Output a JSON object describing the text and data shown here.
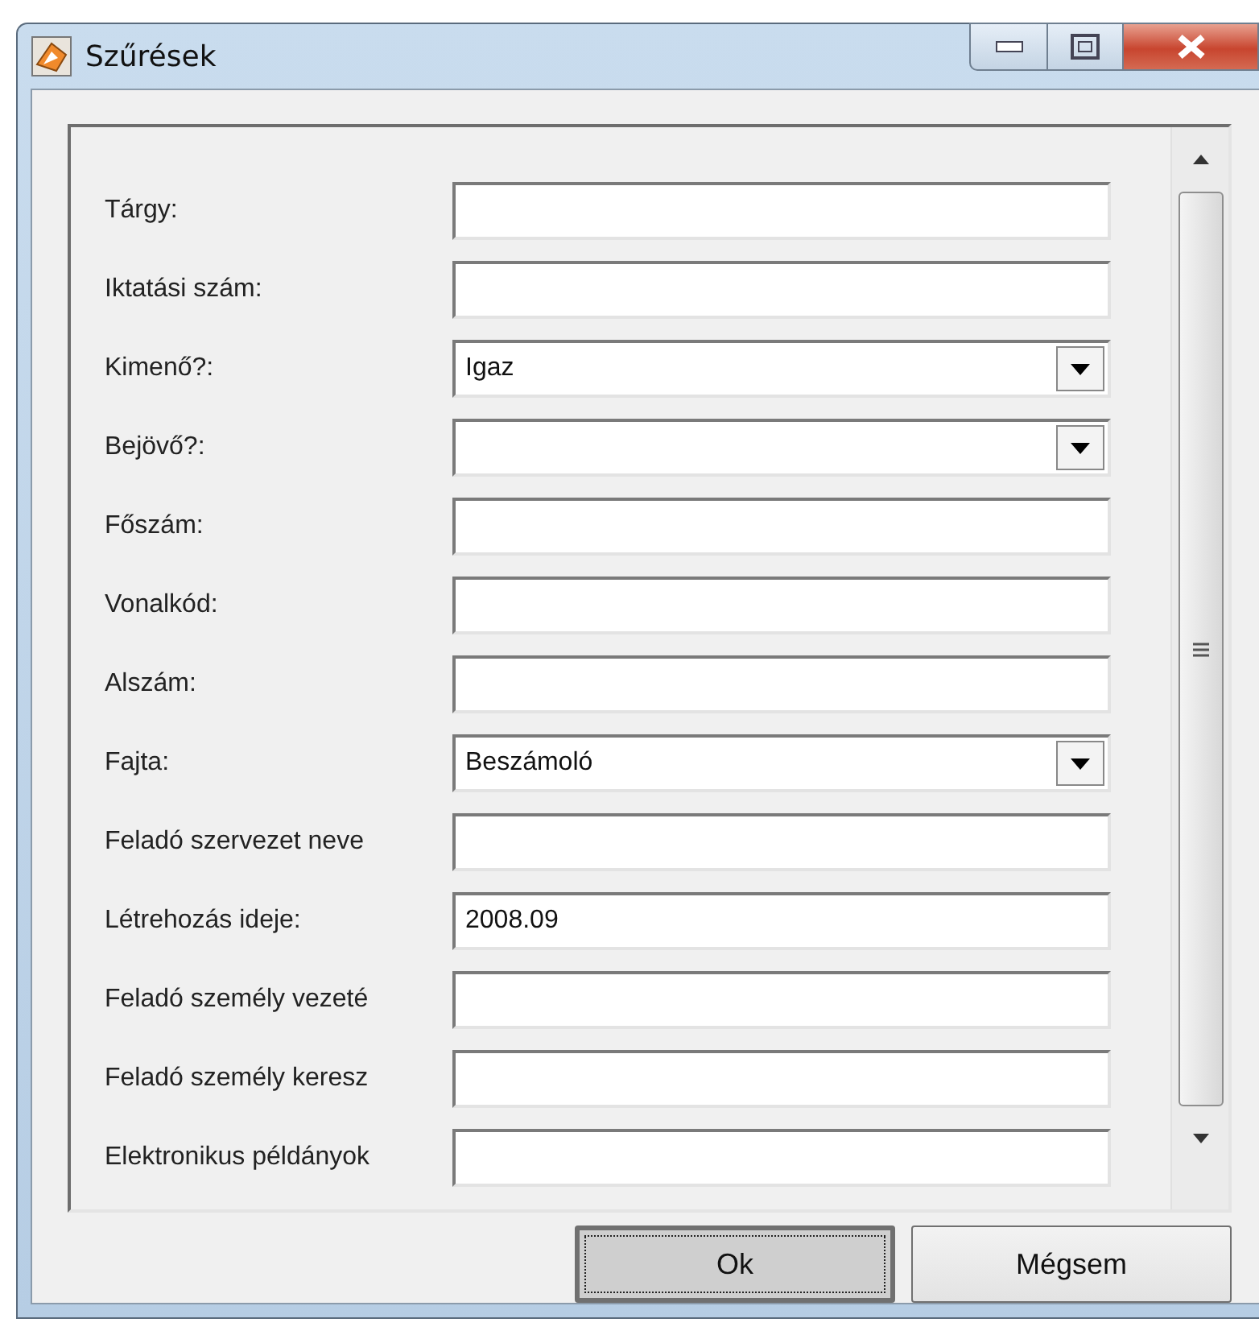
{
  "window": {
    "title": "Szűrések"
  },
  "fields": [
    {
      "label": "Tárgy:",
      "kind": "text"
    },
    {
      "label": "Iktatási szám:",
      "kind": "text"
    },
    {
      "label": "Kimenő?:",
      "kind": "combo",
      "value": "Igaz"
    },
    {
      "label": "Bejövő?:",
      "kind": "combo"
    },
    {
      "label": "Főszám:",
      "kind": "text"
    },
    {
      "label": "Vonalkód:",
      "kind": "text"
    },
    {
      "label": "Alszám:",
      "kind": "text"
    },
    {
      "label": "Fajta:",
      "kind": "combo",
      "value": "Beszámoló"
    },
    {
      "label": "Feladó szervezet neve",
      "kind": "text"
    },
    {
      "label": "Létrehozás ideje:",
      "kind": "text",
      "value": "2008.09"
    },
    {
      "label": "Feladó személy vezeté",
      "kind": "text"
    },
    {
      "label": "Feladó személy keresz",
      "kind": "text"
    },
    {
      "label": "Elektronikus példányok",
      "kind": "text"
    }
  ],
  "buttons": [
    {
      "label": "Ok",
      "focused": true
    },
    {
      "label": "Mégsem",
      "focused": false
    }
  ]
}
